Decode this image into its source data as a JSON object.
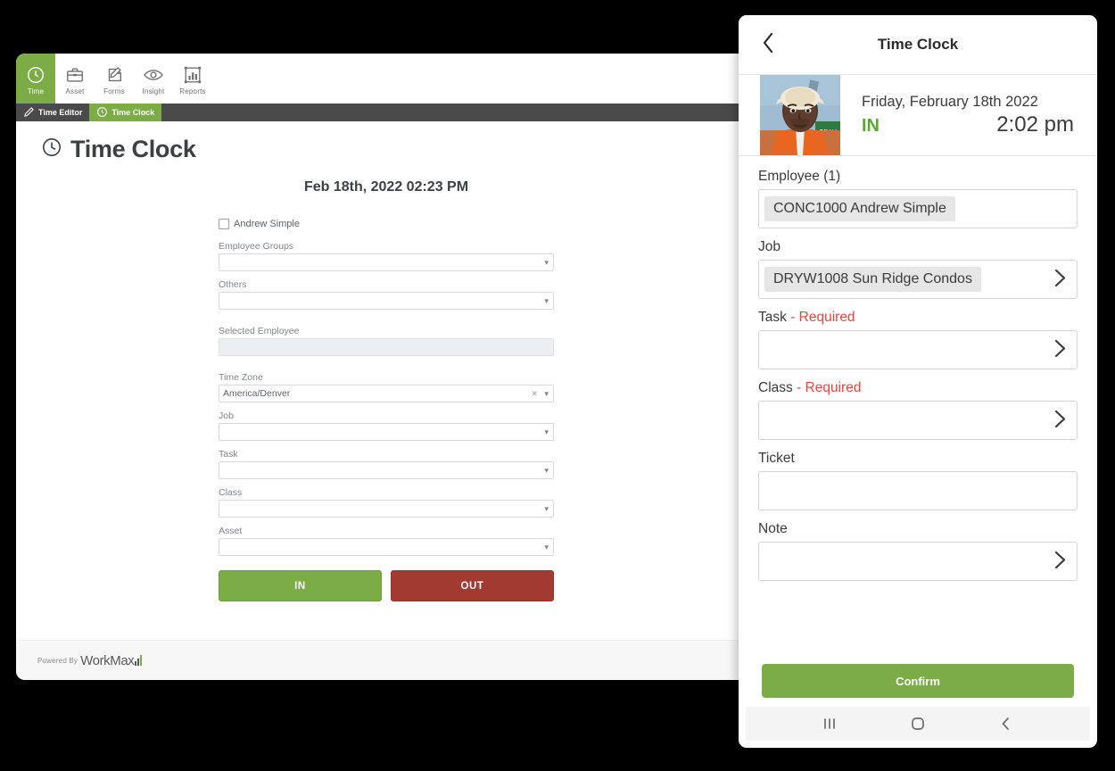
{
  "desktop": {
    "toolbar": {
      "items": [
        {
          "label": "Time",
          "icon": "clock-icon",
          "active": true
        },
        {
          "label": "Asset",
          "icon": "briefcase-icon",
          "active": false
        },
        {
          "label": "Forms",
          "icon": "pencil-form-icon",
          "active": false
        },
        {
          "label": "Insight",
          "icon": "eye-icon",
          "active": false
        },
        {
          "label": "Reports",
          "icon": "bar-chart-icon",
          "active": false
        }
      ]
    },
    "tabs": [
      {
        "label": "Time Editor",
        "icon": "pencil-icon",
        "active": false
      },
      {
        "label": "Time Clock",
        "icon": "clock-icon",
        "active": true
      }
    ],
    "page_title": "Time Clock",
    "datetime_heading": "Feb 18th, 2022 02:23 PM",
    "employee_checkbox": {
      "label": "Andrew Simple",
      "checked": false
    },
    "fields": [
      {
        "label": "Employee Groups",
        "value": "",
        "type": "select"
      },
      {
        "label": "Others",
        "value": "",
        "type": "select"
      },
      {
        "label": "Selected Employee",
        "value": "",
        "type": "readonly"
      },
      {
        "label": "Time Zone",
        "value": "America/Denver",
        "type": "select-clearable"
      },
      {
        "label": "Job",
        "value": "",
        "type": "select"
      },
      {
        "label": "Task",
        "value": "",
        "type": "select"
      },
      {
        "label": "Class",
        "value": "",
        "type": "select"
      },
      {
        "label": "Asset",
        "value": "",
        "type": "select"
      }
    ],
    "buttons": {
      "in_label": "IN",
      "out_label": "OUT"
    },
    "footer": {
      "powered_by": "Powered By",
      "brand": "WorkMax"
    }
  },
  "mobile": {
    "header": {
      "back_icon": "chevron-left-icon",
      "title": "Time Clock"
    },
    "status": {
      "avatar": "employee-photo",
      "date": "Friday, February 18th 2022",
      "state": "IN",
      "time": "2:02 pm"
    },
    "fields": [
      {
        "label": "Employee (1)",
        "required": false,
        "value": "CONC1000   Andrew Simple",
        "chevron": false
      },
      {
        "label": "Job",
        "required": false,
        "value": "DRYW1008 Sun Ridge Condos",
        "chevron": true
      },
      {
        "label": "Task",
        "required": true,
        "required_text": "- Required",
        "value": "",
        "chevron": true
      },
      {
        "label": "Class",
        "required": true,
        "required_text": "- Required",
        "value": "",
        "chevron": true
      },
      {
        "label": "Ticket",
        "required": false,
        "value": "",
        "chevron": false
      },
      {
        "label": "Note",
        "required": false,
        "value": "",
        "chevron": true
      }
    ],
    "confirm_label": "Confirm",
    "navbar": [
      {
        "icon": "recents-icon"
      },
      {
        "icon": "home-icon"
      },
      {
        "icon": "back-icon"
      }
    ]
  },
  "colors": {
    "brand_green": "#7bac46",
    "out_red": "#a33a32",
    "in_green": "#5aa832",
    "required_red": "#e8453c",
    "tab_bar_dark": "#4a4a4a"
  }
}
